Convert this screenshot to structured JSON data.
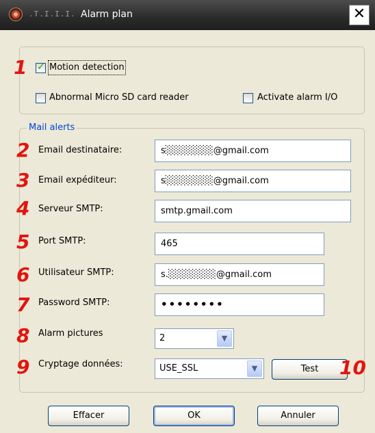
{
  "window": {
    "title_prefix": ".T.I.I.I.",
    "title": "Alarm plan",
    "close_glyph": "✕"
  },
  "detection": {
    "motion": {
      "label": "Motion detection",
      "checked": true
    },
    "sdcard": {
      "label": "Abnormal Micro SD card reader",
      "checked": false
    },
    "alarm_io": {
      "label": "Activate alarm I/O",
      "checked": false
    }
  },
  "mail": {
    "legend": "Mail alerts",
    "email_to": {
      "label": "Email destinataire:",
      "value": "s░░░░░░░@gmail.com"
    },
    "email_from": {
      "label": "Email expéditeur:",
      "value": "s░░░░░░░@gmail.com"
    },
    "smtp_server": {
      "label": "Serveur SMTP:",
      "value": "smtp.gmail.com"
    },
    "smtp_port": {
      "label": "Port SMTP:",
      "value": "465"
    },
    "smtp_user": {
      "label": "Utilisateur SMTP:",
      "value": "s.░░░░░░░@gmail.com"
    },
    "smtp_password": {
      "label": "Password SMTP:",
      "value": "••••••••"
    },
    "alarm_pictures": {
      "label": "Alarm pictures",
      "value": "2"
    },
    "encryption": {
      "label": "Cryptage données:",
      "value": "USE_SSL"
    },
    "test_label": "Test"
  },
  "buttons": {
    "clear": "Effacer",
    "ok": "OK",
    "cancel": "Annuler"
  },
  "annotations": [
    "1",
    "2",
    "3",
    "4",
    "5",
    "6",
    "7",
    "8",
    "9",
    "10"
  ],
  "colors": {
    "annotation": "#e3140e",
    "legend": "#0046d5",
    "title_bar": "#2b2b2b",
    "dialog_bg": "#ece9d8"
  }
}
